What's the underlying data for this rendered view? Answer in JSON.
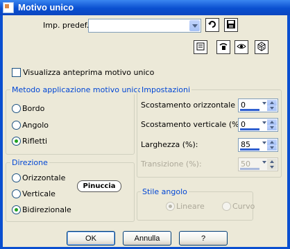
{
  "window": {
    "title": "Motivo unico"
  },
  "preset": {
    "label": "Imp. predef.:",
    "value": ""
  },
  "preview_checkbox": {
    "label": "Visualizza anteprima motivo unico",
    "checked": false
  },
  "method_group": {
    "title": "Metodo applicazione motivo unico",
    "options": [
      {
        "label": "Bordo",
        "selected": false
      },
      {
        "label": "Angolo",
        "selected": false
      },
      {
        "label": "Rifletti",
        "selected": true
      }
    ]
  },
  "direction_group": {
    "title": "Direzione",
    "options": [
      {
        "label": "Orizzontale",
        "selected": false
      },
      {
        "label": "Verticale",
        "selected": false
      },
      {
        "label": "Bidirezionale",
        "selected": true
      }
    ]
  },
  "settings_group": {
    "title": "Impostazioni",
    "fields": [
      {
        "label": "Scostamento orizzontale (%):",
        "value": "0",
        "enabled": true
      },
      {
        "label": "Scostamento verticale (%):",
        "value": "0",
        "enabled": true
      },
      {
        "label": "Larghezza (%):",
        "value": "85",
        "enabled": true
      },
      {
        "label": "Transizione (%):",
        "value": "50",
        "enabled": false
      }
    ]
  },
  "corner_group": {
    "title": "Stile angolo",
    "options": [
      {
        "label": "Lineare",
        "selected": true,
        "enabled": false
      },
      {
        "label": "Curvo",
        "selected": false,
        "enabled": false
      }
    ]
  },
  "watermark": {
    "text": "Pinuccia"
  },
  "buttons": {
    "ok": "OK",
    "cancel": "Annulla",
    "help": "?"
  },
  "icons": {
    "dropdown": "chevron-down-icon",
    "load_preset": "load-preset-icon",
    "save_preset": "save-icon",
    "reset": "reset-icon",
    "proof": "proof-eye-icon",
    "randomize": "random-dice-icon"
  }
}
